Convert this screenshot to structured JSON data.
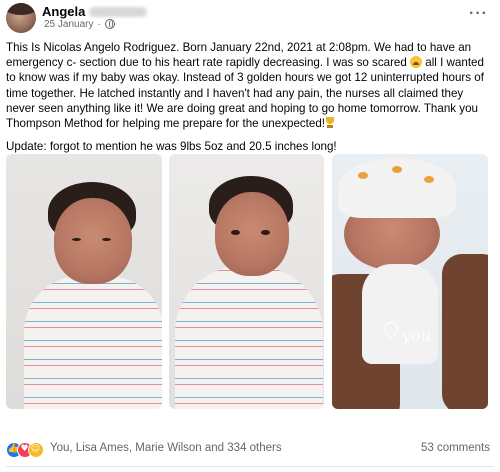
{
  "post": {
    "author": "Angela",
    "date": "25 January",
    "body": [
      "This Is Nicolas Angelo Rodriguez. Born January 22nd, 2021 at 2:08pm. We had to have an emergency c- section due to his heart rate rapidly decreasing. I was so scared",
      " all I wanted to know was if my baby was okay. Instead of 3 golden hours we got 12 uninterrupted hours of time together. He latched instantly and I haven't had any pain, the nurses all claimed they never seen anything like it! We are doing great and hoping to go home tomorrow. Thank you Thompson Method for helping me prepare for the unexpected!"
    ],
    "update": "Update: forgot to mention he was 9lbs 5oz and 20.5 inches long!",
    "photo_caption_script": "you"
  },
  "footer": {
    "reactions": [
      "like",
      "love",
      "care"
    ],
    "reaction_names": "You, Lisa Ames, Marie Wilson and 334 others",
    "comments": "53 comments"
  },
  "icons": {
    "privacy": "globe-icon",
    "more": "more-options-icon",
    "inline_emoji_1": "scared-face-emoji",
    "inline_emoji_2": "trophy-emoji"
  },
  "colors": {
    "text": "#050505",
    "secondary": "#65676b",
    "like": "#1877f2",
    "love": "#f33e58",
    "care": "#f7b928"
  }
}
